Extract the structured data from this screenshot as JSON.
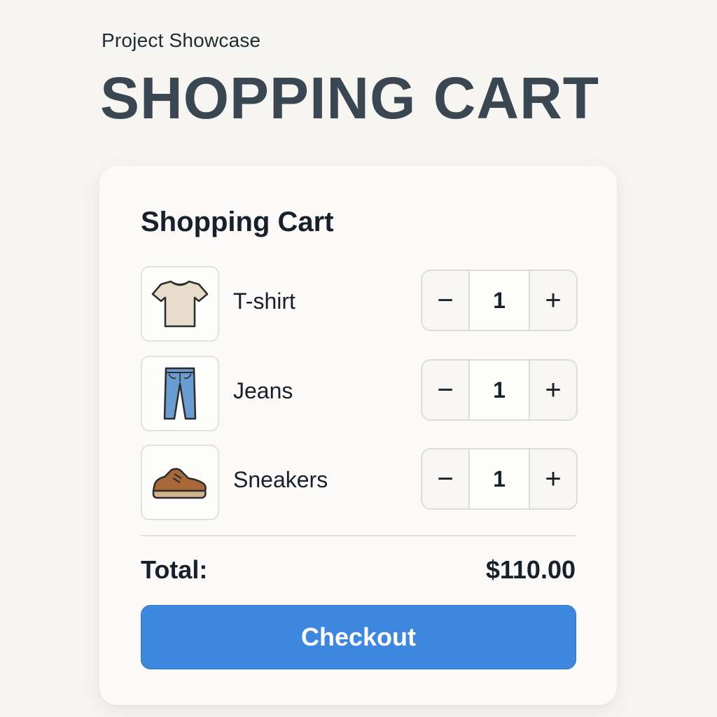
{
  "header": {
    "eyebrow": "Project Showcase",
    "title": "SHOPPING CART"
  },
  "cart": {
    "title": "Shopping Cart",
    "items": [
      {
        "name": "T-shirt",
        "quantity": "1",
        "icon": "t-shirt-icon",
        "decrement": "−",
        "increment": "+"
      },
      {
        "name": "Jeans",
        "quantity": "1",
        "icon": "jeans-icon",
        "decrement": "−",
        "increment": "+"
      },
      {
        "name": "Sneakers",
        "quantity": "1",
        "icon": "sneaker-icon",
        "decrement": "−",
        "increment": "+"
      }
    ],
    "total_label": "Total:",
    "total_value": "$110.00",
    "checkout_label": "Checkout"
  },
  "colors": {
    "background": "#f6f5f2",
    "card": "#fbfaf8",
    "accent": "#3d87de",
    "heading": "#3a4753",
    "text": "#17202b"
  }
}
